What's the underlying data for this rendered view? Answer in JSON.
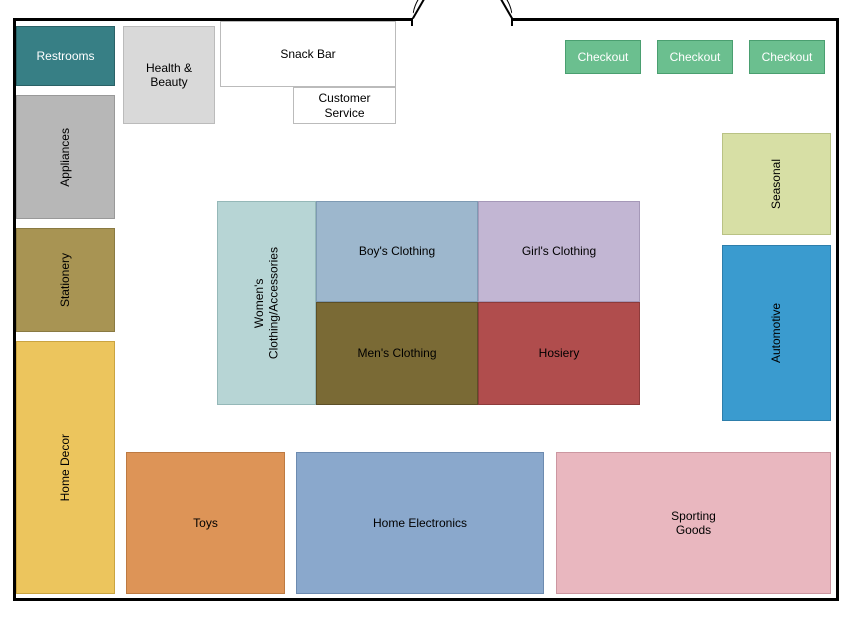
{
  "departments": {
    "restrooms": "Restrooms",
    "health_beauty": "Health &\nBeauty",
    "snack_bar": "Snack Bar",
    "customer_service": "Customer Service",
    "appliances": "Appliances",
    "stationery": "Stationery",
    "home_decor": "Home Decor",
    "womens": "Women's\nClothing/Accessories",
    "boys": "Boy's Clothing",
    "girls": "Girl's Clothing",
    "mens": "Men's Clothing",
    "hosiery": "Hosiery",
    "seasonal": "Seasonal",
    "automotive": "Automotive",
    "toys": "Toys",
    "home_electronics": "Home Electronics",
    "sporting_goods": "Sporting\nGoods"
  },
  "checkout": {
    "label": "Checkout"
  },
  "layout_type": "store-floor-plan"
}
